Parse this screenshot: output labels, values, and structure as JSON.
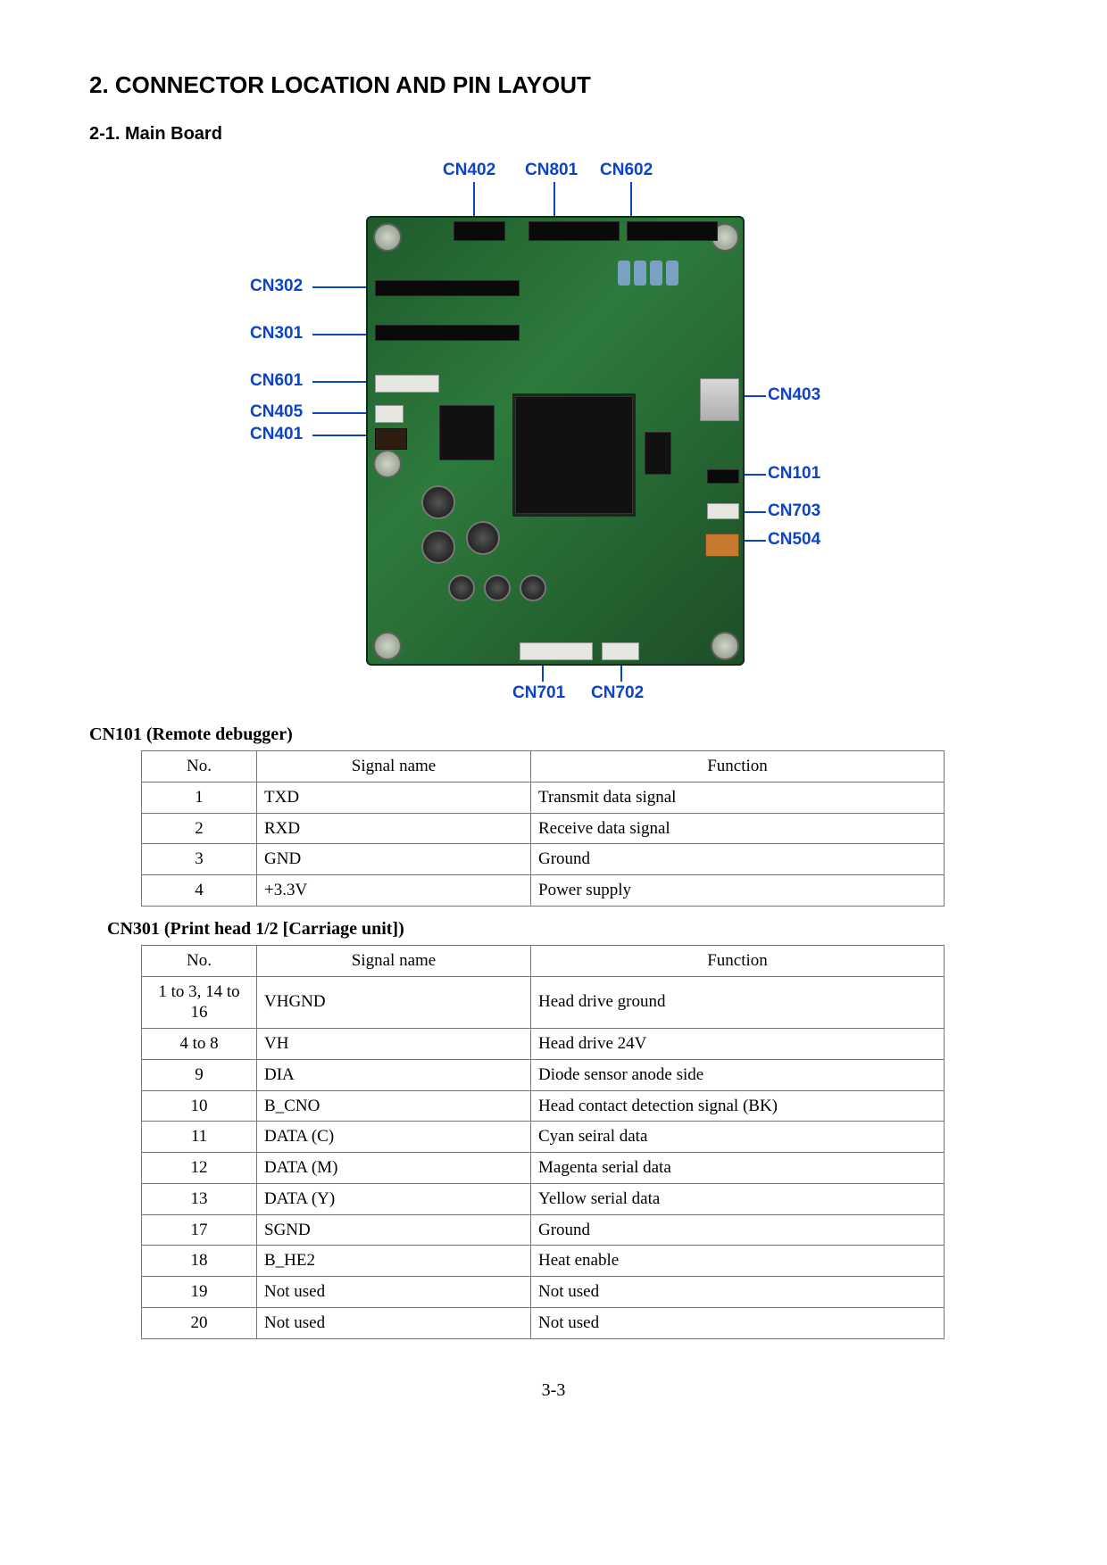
{
  "headings": {
    "section": "2.  CONNECTOR LOCATION AND PIN LAYOUT",
    "subsection": "2-1.  Main Board"
  },
  "figure": {
    "callouts": {
      "top1": "CN402",
      "top2": "CN801",
      "top3": "CN602",
      "left1": "CN302",
      "left2": "CN301",
      "left3": "CN601",
      "left4": "CN405",
      "left5": "CN401",
      "right1": "CN403",
      "right2": "CN101",
      "right3": "CN703",
      "right4": "CN504",
      "bottom1": "CN701",
      "bottom2": "CN702"
    }
  },
  "tables": [
    {
      "title": "CN101 (Remote debugger)",
      "headers": {
        "no": "No.",
        "signal": "Signal name",
        "function": "Function"
      },
      "rows": [
        {
          "no": "1",
          "signal": "TXD",
          "function": "Transmit data signal"
        },
        {
          "no": "2",
          "signal": "RXD",
          "function": "Receive data signal"
        },
        {
          "no": "3",
          "signal": "GND",
          "function": "Ground"
        },
        {
          "no": "4",
          "signal": "+3.3V",
          "function": "Power supply"
        }
      ]
    },
    {
      "title": "CN301 (Print head 1/2 [Carriage unit])",
      "headers": {
        "no": "No.",
        "signal": "Signal name",
        "function": "Function"
      },
      "rows": [
        {
          "no": "1 to 3, 14 to 16",
          "signal": "VHGND",
          "function": "Head drive ground"
        },
        {
          "no": "4 to 8",
          "signal": "VH",
          "function": "Head drive 24V"
        },
        {
          "no": "9",
          "signal": "DIA",
          "function": "Diode sensor anode side"
        },
        {
          "no": "10",
          "signal": "B_CNO",
          "function": "Head contact detection signal (BK)"
        },
        {
          "no": "11",
          "signal": "DATA (C)",
          "function": "Cyan seiral data"
        },
        {
          "no": "12",
          "signal": "DATA (M)",
          "function": "Magenta serial data"
        },
        {
          "no": "13",
          "signal": "DATA (Y)",
          "function": "Yellow serial data"
        },
        {
          "no": "17",
          "signal": "SGND",
          "function": "Ground"
        },
        {
          "no": "18",
          "signal": "B_HE2",
          "function": "Heat enable"
        },
        {
          "no": "19",
          "signal": "Not used",
          "function": "Not used"
        },
        {
          "no": "20",
          "signal": "Not used",
          "function": "Not used"
        }
      ]
    }
  ],
  "page_number": "3-3"
}
